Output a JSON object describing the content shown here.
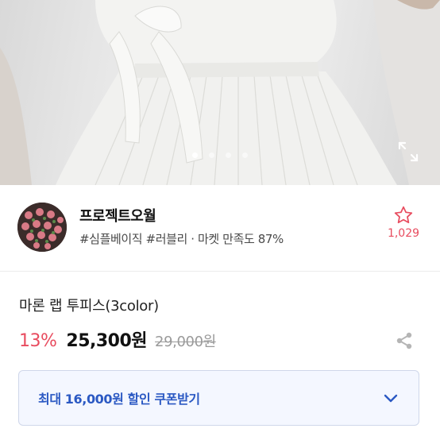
{
  "gallery": {
    "slide_count": 4,
    "active_slide": 1,
    "expand_icon": "expand-icon"
  },
  "seller": {
    "name": "프로젝트오월",
    "tags_and_rating": "#심플베이직 #러블리 · 마켓 만족도 87%",
    "like_count": "1,029",
    "like_icon": "star-outline-icon"
  },
  "product": {
    "title": "마론 랩 투피스(3color)",
    "discount_rate": "13%",
    "price": "25,300원",
    "original_price": "29,000원",
    "share_icon": "share-icon"
  },
  "coupon": {
    "label": "최대 16,000원 할인 쿠폰받기",
    "chevron_icon": "chevron-down-icon"
  },
  "colors": {
    "accent_red": "#e84c5f",
    "accent_blue": "#2b59c3",
    "coupon_bg": "#f4f7ff"
  }
}
